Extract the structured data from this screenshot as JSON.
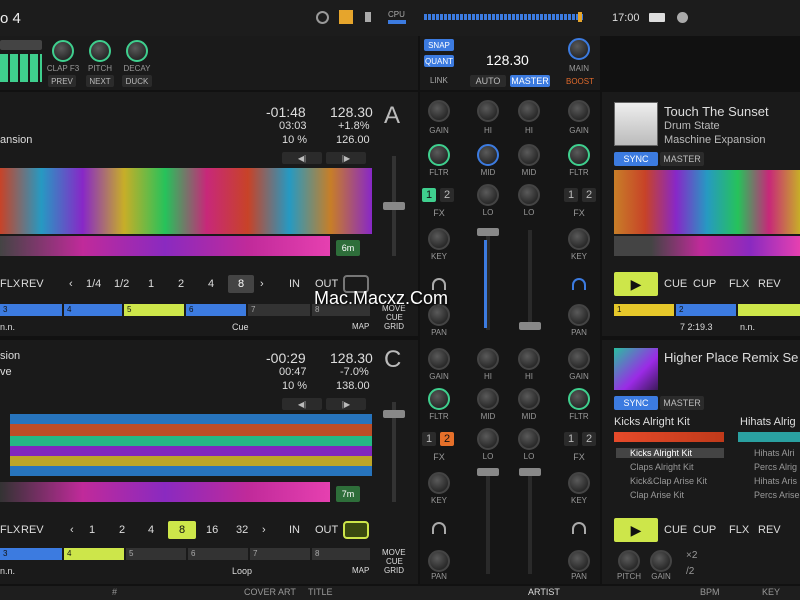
{
  "topbar": {
    "logo": "o 4",
    "time": "17:00",
    "cpu": "CPU"
  },
  "fx_unit": {
    "knobs": [
      "CLAP F3",
      "PITCH",
      "DECAY"
    ],
    "buttons": [
      "PREV",
      "NEXT",
      "DUCK"
    ]
  },
  "master": {
    "snap": "SNAP",
    "quant": "QUANT",
    "link": "LINK",
    "tempo": "128.30",
    "auto": "AUTO",
    "master": "MASTER",
    "main": "MAIN",
    "boost": "BOOST"
  },
  "deckA": {
    "title": "ansion",
    "time1": "-01:48",
    "time2": "03:03",
    "pct": "10 %",
    "bpm": "128.30",
    "pitch": "+1.8%",
    "base": "126.00",
    "letter": "A",
    "loop_len": "6m",
    "buttons": {
      "flx": "FLX",
      "rev": "REV",
      "in": "IN",
      "out": "OUT"
    },
    "loop_sizes": [
      "1/4",
      "1/2",
      "1",
      "2",
      "4",
      "8"
    ],
    "cue_nums": [
      "3",
      "4",
      "5",
      "6",
      "7",
      "8"
    ],
    "bottom": {
      "nn": "n.n.",
      "cue": "Cue",
      "map": "MAP"
    }
  },
  "deckC": {
    "title": "sion",
    "subtitle": "ve",
    "time1": "-00:29",
    "time2": "00:47",
    "pct": "10 %",
    "bpm": "128.30",
    "pitch": "-7.0%",
    "base": "138.00",
    "letter": "C",
    "loop_len": "7m",
    "buttons": {
      "flx": "FLX",
      "rev": "REV",
      "in": "IN",
      "out": "OUT"
    },
    "loop_sizes": [
      "1",
      "2",
      "4",
      "8",
      "16",
      "32"
    ],
    "cue_nums": [
      "3",
      "4",
      "5",
      "6",
      "7",
      "8"
    ],
    "bottom": {
      "nn": "n.n.",
      "loop": "Loop",
      "map": "MAP"
    }
  },
  "deckB": {
    "title": "Touch The Sunset",
    "artist": "Drum State",
    "album": "Maschine Expansion",
    "sync": "SYNC",
    "master": "MASTER",
    "transport": {
      "cue": "CUE",
      "cup": "CUP",
      "flx": "FLX",
      "rev": "REV"
    },
    "info": "7 2:19.3",
    "nn": "n.n.",
    "cue_nums": [
      "1",
      "2"
    ]
  },
  "deckD": {
    "title": "Higher Place Remix Se",
    "sync": "SYNC",
    "master": "MASTER",
    "slot1": "Kicks Alright Kit",
    "slot2": "Hihats Alrig",
    "slot1_items": [
      "Kicks Alright Kit",
      "Claps Alright Kit",
      "Kick&Clap Arise Kit",
      "Clap Arise Kit"
    ],
    "slot2_items": [
      "Hihats Alri",
      "Percs Alrig",
      "Hihats Aris",
      "Percs Arise"
    ],
    "transport": {
      "cue": "CUE",
      "cup": "CUP",
      "flx": "FLX",
      "rev": "REV"
    },
    "knobs": [
      "PITCH",
      "GAIN"
    ],
    "x2": "×2",
    "div2": "/2"
  },
  "mixer": {
    "gain": "GAIN",
    "hi": "HI",
    "mid": "MID",
    "lo": "LO",
    "fltr": "FLTR",
    "fx": "FX",
    "key": "KEY",
    "pan": "PAN",
    "fx_a": [
      "1",
      "2"
    ],
    "fx_b": [
      "1",
      "2"
    ],
    "fx_c": [
      "1",
      "2"
    ],
    "fx_d": [
      "1",
      "2"
    ]
  },
  "move": {
    "move": "MOVE",
    "cue": "CUE",
    "grid": "GRID"
  },
  "browser": {
    "cols": [
      "#",
      "COVER ART",
      "TITLE",
      "ARTIST",
      "BPM",
      "KEY"
    ]
  },
  "watermark": "Mac.Macxz.Com"
}
